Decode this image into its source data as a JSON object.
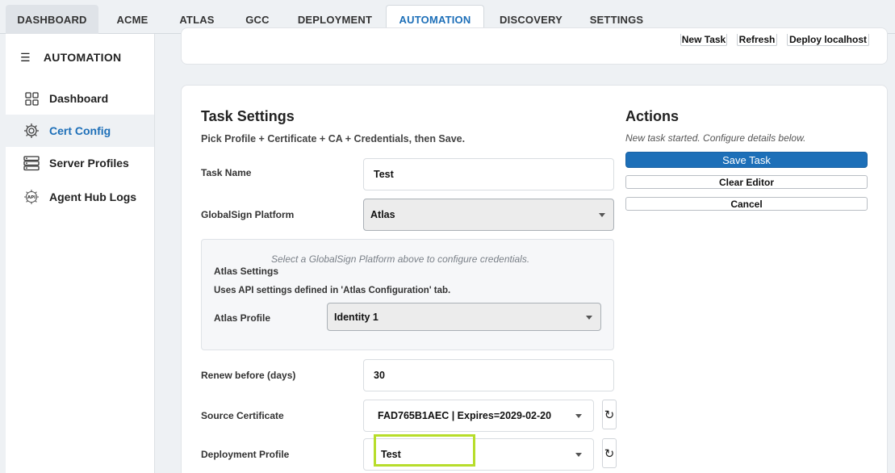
{
  "tabs": [
    {
      "label": "DASHBOARD"
    },
    {
      "label": "ACME"
    },
    {
      "label": "ATLAS"
    },
    {
      "label": "GCC"
    },
    {
      "label": "DEPLOYMENT"
    },
    {
      "label": "AUTOMATION"
    },
    {
      "label": "DISCOVERY"
    },
    {
      "label": "SETTINGS"
    }
  ],
  "active_tab": "AUTOMATION",
  "sidebar": {
    "title": "AUTOMATION",
    "items": [
      {
        "label": "Dashboard",
        "icon": "grid-icon"
      },
      {
        "label": "Cert Config",
        "icon": "gear-icon"
      },
      {
        "label": "Server Profiles",
        "icon": "server-icon"
      },
      {
        "label": "Agent Hub Logs",
        "icon": "api-gear-icon"
      }
    ],
    "active_item": "Cert Config"
  },
  "toolbar": {
    "new_task": "New Task",
    "refresh": "Refresh",
    "deploy": "Deploy localhost"
  },
  "task_settings": {
    "title": "Task Settings",
    "subtitle": "Pick Profile + Certificate + CA + Credentials, then Save.",
    "task_name_label": "Task Name",
    "task_name_value": "Test",
    "platform_label": "GlobalSign Platform",
    "platform_value": "Atlas",
    "platform_hint": "Select a GlobalSign Platform above to configure credentials.",
    "atlas_settings_title": "Atlas Settings",
    "atlas_settings_desc": "Uses API settings defined in 'Atlas Configuration' tab.",
    "atlas_profile_label": "Atlas Profile",
    "atlas_profile_value": "Identity 1",
    "renew_label": "Renew before (days)",
    "renew_value": "30",
    "source_cert_label": "Source Certificate",
    "source_cert_value": "FAD765B1AEC | Expires=2029-02-20",
    "deploy_profile_label": "Deployment Profile",
    "deploy_profile_value": "Test"
  },
  "actions": {
    "title": "Actions",
    "status": "New task started. Configure details below.",
    "save": "Save Task",
    "clear": "Clear Editor",
    "cancel": "Cancel"
  },
  "colors": {
    "accent": "#1d6fb8",
    "highlight": "#b7dd2b"
  }
}
